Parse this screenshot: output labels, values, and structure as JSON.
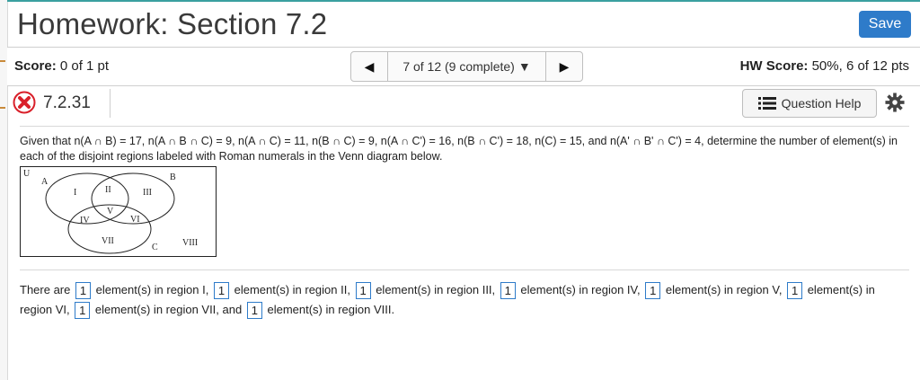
{
  "header": {
    "title": "Homework: Section 7.2",
    "save_label": "Save"
  },
  "scorebar": {
    "score_label": "Score:",
    "score_value": "0 of 1 pt",
    "nav_position": "7 of 12 (9 complete)",
    "hw_score_label": "HW Score:",
    "hw_score_value": "50%, 6 of 12 pts"
  },
  "question": {
    "number": "7.2.31",
    "status_icon": "x-circle-icon",
    "help_label": "Question Help",
    "prompt": "Given that n(A ∩ B) = 17, n(A ∩ B ∩ C) = 9, n(A ∩ C)  = 11, n(B ∩ C) = 9,  n(A ∩ C') = 16, n(B ∩ C') = 18, n(C) = 15, and n(A' ∩ B' ∩ C') = 4, determine the number of element(s) in each of the disjoint regions labeled with Roman numerals in the Venn diagram below."
  },
  "venn": {
    "universe_label": "U",
    "set_labels": [
      "A",
      "B",
      "C"
    ],
    "regions": [
      "I",
      "II",
      "III",
      "IV",
      "V",
      "VI",
      "VII",
      "VIII"
    ]
  },
  "answer": {
    "lead": "There are",
    "values": [
      "1",
      "1",
      "1",
      "1",
      "1",
      "1",
      "1",
      "1"
    ],
    "suffixes": [
      "element(s) in region I,",
      "element(s) in region II,",
      "element(s) in region III,",
      "element(s) in region IV,",
      "element(s) in region V,",
      "element(s) in region VI,",
      "element(s) in region VII, and",
      "element(s) in region VIII."
    ]
  },
  "colors": {
    "accent": "#2e7bc9",
    "error": "#d9202a"
  }
}
